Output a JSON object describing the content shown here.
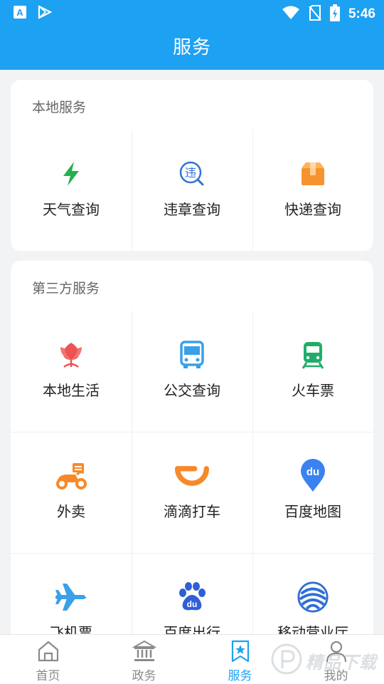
{
  "status_bar": {
    "time": "5:46"
  },
  "app_bar": {
    "title": "服务"
  },
  "local_services": {
    "title": "本地服务",
    "items": [
      {
        "label": "天气查询",
        "icon": "lightning-icon",
        "color": "#22b14c"
      },
      {
        "label": "违章查询",
        "icon": "violation-search-icon",
        "color": "#2f74d6",
        "icon_text": "违"
      },
      {
        "label": "快递查询",
        "icon": "package-box-icon",
        "color": "#f7932f"
      }
    ]
  },
  "third_party_services": {
    "title": "第三方服务",
    "items": [
      {
        "label": "本地生活",
        "icon": "tulip-icon",
        "color": "#ee5253"
      },
      {
        "label": "公交查询",
        "icon": "bus-icon",
        "color": "#3aa0e8"
      },
      {
        "label": "火车票",
        "icon": "train-icon",
        "color": "#1fae6a"
      },
      {
        "label": "外卖",
        "icon": "scooter-icon",
        "color": "#f7892a"
      },
      {
        "label": "滴滴打车",
        "icon": "didi-icon",
        "color": "#f7892a"
      },
      {
        "label": "百度地图",
        "icon": "map-pin-icon",
        "color": "#3b82f0",
        "icon_text": "du"
      },
      {
        "label": "飞机票",
        "icon": "airplane-icon",
        "color": "#3aa0e8"
      },
      {
        "label": "百度出行",
        "icon": "baidu-paw-icon",
        "color": "#2f5fd6",
        "icon_text": "du"
      },
      {
        "label": "移动营业厅",
        "icon": "china-mobile-icon",
        "color": "#2f6fd6"
      }
    ]
  },
  "bottom_nav": {
    "active_color": "#1da1f2",
    "items": [
      {
        "label": "首页",
        "icon": "home-icon"
      },
      {
        "label": "政务",
        "icon": "government-building-icon"
      },
      {
        "label": "服务",
        "icon": "service-bookmark-icon",
        "active": true
      },
      {
        "label": "我的",
        "icon": "user-icon"
      }
    ]
  },
  "watermark": {
    "text": "精品下载"
  }
}
